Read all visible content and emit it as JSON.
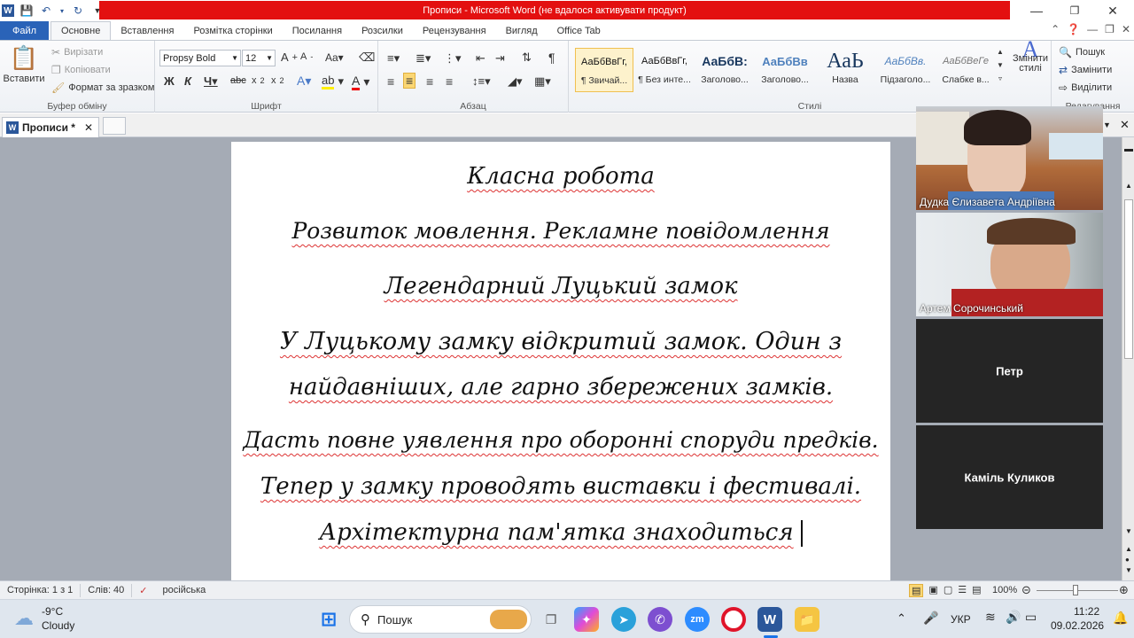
{
  "title": "Прописи  -  Microsoft Word (не вдалося активувати продукт)",
  "ribbon_tabs": [
    "Файл",
    "Основне",
    "Вставлення",
    "Розмітка сторінки",
    "Посилання",
    "Розсилки",
    "Рецензування",
    "Вигляд",
    "Office Tab"
  ],
  "clipboard": {
    "paste": "Вставити",
    "cut": "Вирізати",
    "copy": "Копіювати",
    "format_painter": "Формат за зразком",
    "label": "Буфер обміну"
  },
  "font": {
    "name": "Propsy Bold",
    "size": "12",
    "label": "Шрифт"
  },
  "paragraph": {
    "label": "Абзац"
  },
  "styles": {
    "label": "Стилі",
    "items": [
      {
        "sample": "АаБбВвГг,",
        "name": "¶ Звичай..."
      },
      {
        "sample": "АаБбВвГг,",
        "name": "¶ Без инте..."
      },
      {
        "sample": "АаБбВ:",
        "name": "Заголово..."
      },
      {
        "sample": "АаБбВв",
        "name": "Заголово..."
      },
      {
        "sample": "АаЬ",
        "name": "Назва"
      },
      {
        "sample": "АаБбВв.",
        "name": "Підзаголо..."
      },
      {
        "sample": "АаБбВеГе",
        "name": "Слабке в..."
      }
    ],
    "change_styles": "Змінити стилі"
  },
  "editing": {
    "find": "Пошук",
    "replace": "Замінити",
    "select": "Виділити",
    "label": "Редагування"
  },
  "doc_tab": "Прописи *",
  "document_lines": [
    "Класна робота",
    "Розвиток мовлення. Рекламне повідомлення",
    "Легендарний Луцький замок",
    "У Луцькому замку відкритий замок. Один з",
    "найдавніших, але гарно збережених замків.",
    "Дасть повне уявлення про оборонні споруди предків.",
    "Тепер у замку проводять виставки і фестивалі.",
    "Архітектурна пам'ятка знаходиться"
  ],
  "participants": [
    {
      "name": "Дудка Єлизавета Андріївна",
      "type": "video"
    },
    {
      "name": "Артем Сорочинський",
      "type": "video"
    },
    {
      "name": "Петр",
      "type": "name"
    },
    {
      "name": "Каміль Куликов",
      "type": "name"
    }
  ],
  "status": {
    "page": "Сторінка: 1 з 1",
    "words": "Слів: 40",
    "language": "російська",
    "zoom": "100%"
  },
  "taskbar": {
    "temp": "-9°C",
    "weather": "Cloudy",
    "search": "Пошук",
    "lang": "УКР",
    "time": "11:22",
    "date": "09.02.2026"
  },
  "colors": {
    "title_bar": "#e31010",
    "file_tab": "#2a63b8",
    "workspace": "#a5abb5"
  }
}
